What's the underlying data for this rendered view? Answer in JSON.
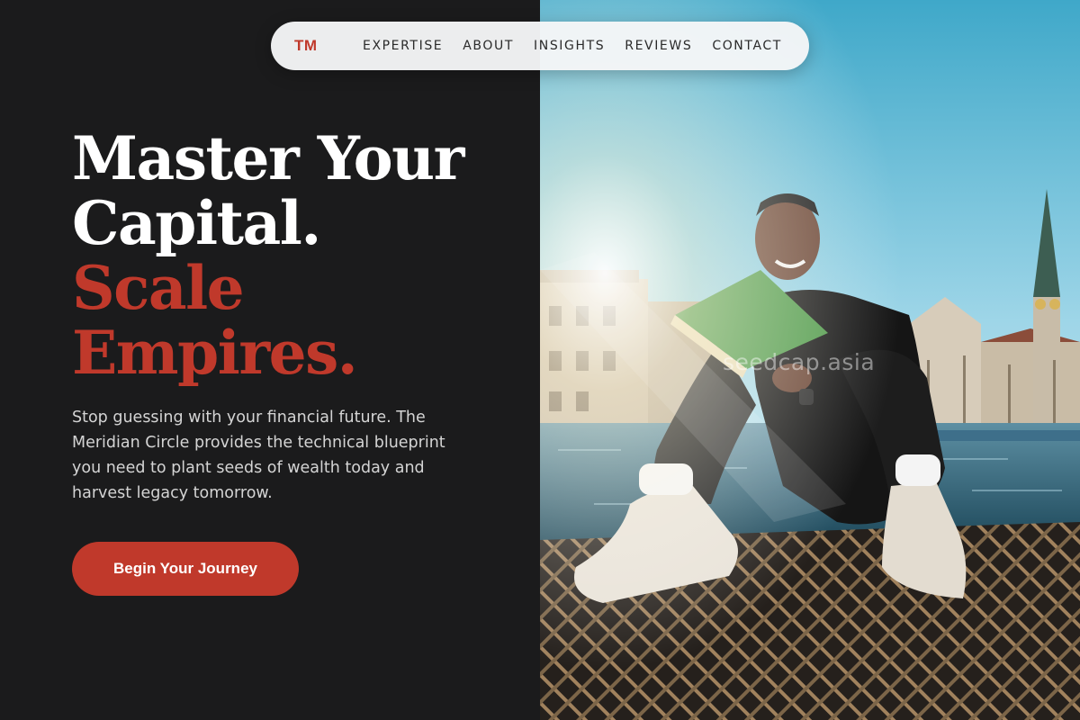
{
  "nav": {
    "logo": "TM",
    "links": [
      "EXPERTISE",
      "ABOUT",
      "INSIGHTS",
      "REVIEWS",
      "CONTACT"
    ]
  },
  "hero": {
    "headline_line1": "Master Your",
    "headline_line2": "Capital.",
    "headline_line3": "Scale",
    "headline_line4": "Empires.",
    "subtext": "Stop guessing with your financial future. The Meridian Circle provides the technical blueprint you need to plant seeds of wealth today and harvest legacy tomorrow.",
    "cta_label": "Begin Your Journey"
  },
  "image": {
    "watermark": "seedcap.asia"
  },
  "colors": {
    "accent": "#c0392b",
    "background": "#1b1b1c",
    "nav_bg": "#f5f6f7"
  }
}
